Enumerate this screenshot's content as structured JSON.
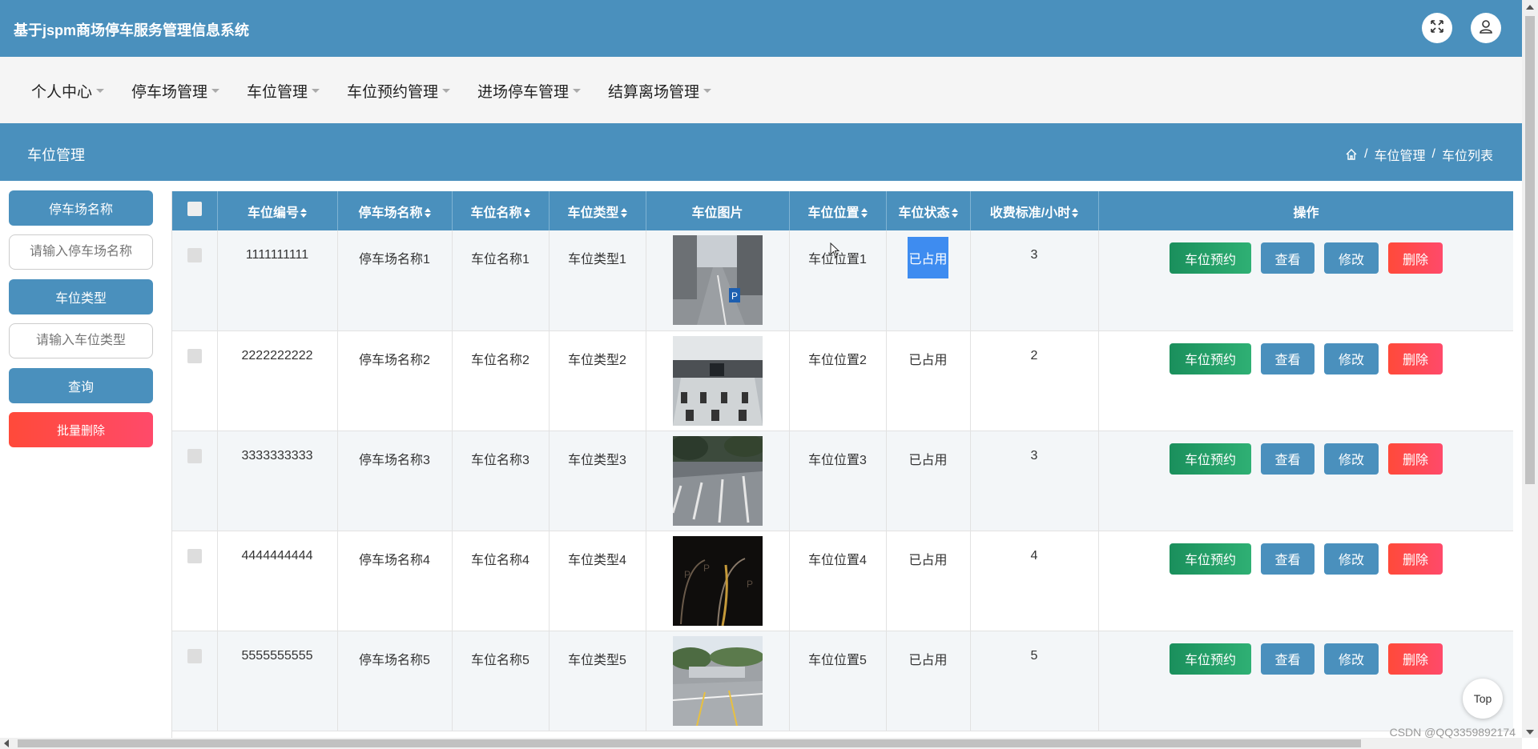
{
  "header": {
    "app_title": "基于jspm商场停车服务管理信息系统",
    "fullscreen_icon": "fullscreen-icon",
    "user_icon": "user-icon"
  },
  "nav": {
    "items": [
      "个人中心",
      "停车场管理",
      "车位管理",
      "车位预约管理",
      "进场停车管理",
      "结算离场管理"
    ]
  },
  "breadcrumb": {
    "page_title": "车位管理",
    "home_icon": "home-icon",
    "path": [
      "车位管理",
      "车位列表"
    ],
    "separator": "/"
  },
  "filters": {
    "parking_lot_label": "停车场名称",
    "parking_lot_placeholder": "请输入停车场名称",
    "space_type_label": "车位类型",
    "space_type_placeholder": "请输入车位类型",
    "query_button": "查询",
    "batch_delete_button": "批量删除"
  },
  "table": {
    "columns": [
      "车位编号",
      "停车场名称",
      "车位名称",
      "车位类型",
      "车位图片",
      "车位位置",
      "车位状态",
      "收费标准/小时",
      "操作"
    ],
    "rows": [
      {
        "id": "1111111111",
        "lot": "停车场名称1",
        "name": "车位名称1",
        "type": "车位类型1",
        "location": "车位位置1",
        "status": "已占用",
        "fee": "3"
      },
      {
        "id": "2222222222",
        "lot": "停车场名称2",
        "name": "车位名称2",
        "type": "车位类型2",
        "location": "车位位置2",
        "status": "已占用",
        "fee": "2"
      },
      {
        "id": "3333333333",
        "lot": "停车场名称3",
        "name": "车位名称3",
        "type": "车位类型3",
        "location": "车位位置3",
        "status": "已占用",
        "fee": "3"
      },
      {
        "id": "4444444444",
        "lot": "停车场名称4",
        "name": "车位名称4",
        "type": "车位类型4",
        "location": "车位位置4",
        "status": "已占用",
        "fee": "4"
      },
      {
        "id": "5555555555",
        "lot": "停车场名称5",
        "name": "车位名称5",
        "type": "车位类型5",
        "location": "车位位置5",
        "status": "已占用",
        "fee": "5"
      }
    ],
    "actions": {
      "reserve": "车位预约",
      "view": "查看",
      "edit": "修改",
      "delete": "删除"
    }
  },
  "top_button": "Top",
  "watermark": "CSDN @QQ3359892174",
  "colors": {
    "primary": "#4a90bd",
    "success": "#1a8f5c",
    "danger": "#ff4a4a",
    "selection": "#3e8cf0"
  }
}
